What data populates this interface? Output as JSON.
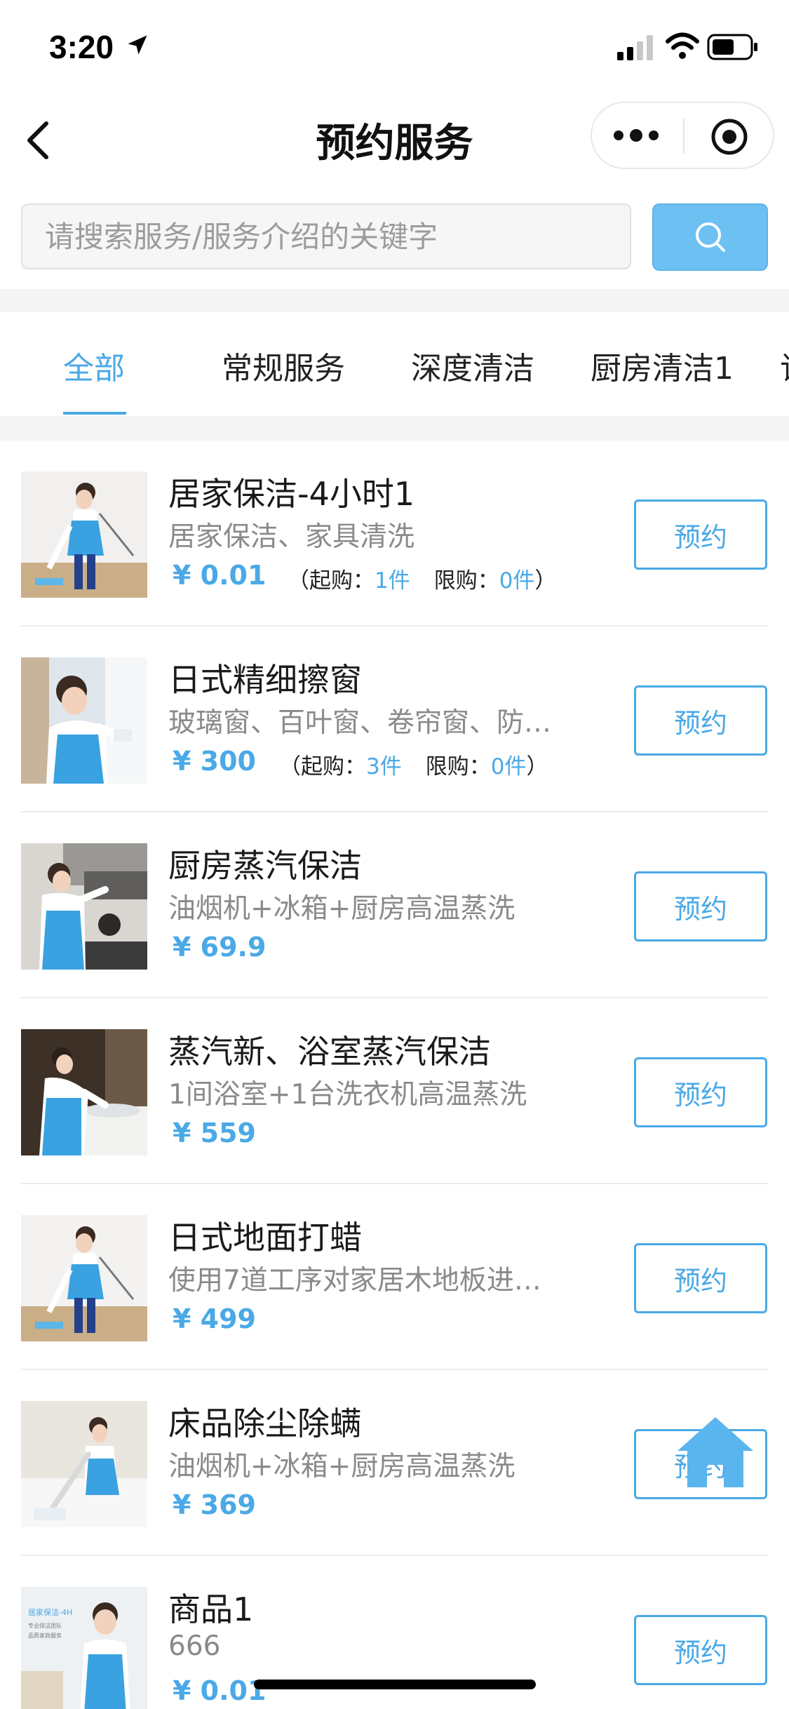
{
  "status_bar": {
    "time": "3:20"
  },
  "nav": {
    "title": "预约服务"
  },
  "search": {
    "placeholder": "请搜索服务/服务介绍的关键字"
  },
  "tabs": [
    {
      "label": "全部",
      "active": true
    },
    {
      "label": "常规服务"
    },
    {
      "label": "深度清洁"
    },
    {
      "label": "厨房清洁1"
    },
    {
      "label": "该"
    }
  ],
  "items": [
    {
      "title": "居家保洁-4小时1",
      "desc": "居家保洁、家具清洗",
      "price": "¥ 0.01",
      "min_label": "（起购：",
      "min_value": "1件",
      "max_label": "限购：",
      "max_value": "0件",
      "close": "）",
      "button": "预约",
      "image": "cleaner-mopping-photo"
    },
    {
      "title": "日式精细擦窗",
      "desc": "玻璃窗、百叶窗、卷帘窗、防…",
      "price": "¥ 300",
      "min_label": "（起购：",
      "min_value": "3件",
      "max_label": "限购：",
      "max_value": "0件",
      "close": "）",
      "button": "预约",
      "image": "cleaner-window-photo"
    },
    {
      "title": "厨房蒸汽保洁",
      "desc": "油烟机+冰箱+厨房高温蒸洗",
      "price": "¥ 69.9",
      "button": "预约",
      "image": "cleaner-kitchen-photo"
    },
    {
      "title": "蒸汽新、浴室蒸汽保洁",
      "desc": "1间浴室+1台洗衣机高温蒸洗",
      "price": "¥ 559",
      "button": "预约",
      "image": "cleaner-bathroom-photo"
    },
    {
      "title": "日式地面打蜡",
      "desc": "使用7道工序对家居木地板进…",
      "price": "¥ 499",
      "button": "预约",
      "image": "cleaner-floor-photo"
    },
    {
      "title": "床品除尘除螨",
      "desc": "油烟机+冰箱+厨房高温蒸洗",
      "price": "¥ 369",
      "button": "预约",
      "image": "cleaner-vacuum-photo"
    },
    {
      "title": "商品1",
      "desc": "666",
      "price": "¥ 0.01",
      "button": "预约",
      "image": "promo-poster-photo"
    }
  ],
  "thumb_texts": {
    "poster_line1": "居家保洁-4H",
    "poster_line2": "专业保洁团队",
    "poster_line3": "品质家政服务"
  },
  "colors": {
    "accent": "#4aa9e6",
    "search_button": "#6cc0f2"
  }
}
